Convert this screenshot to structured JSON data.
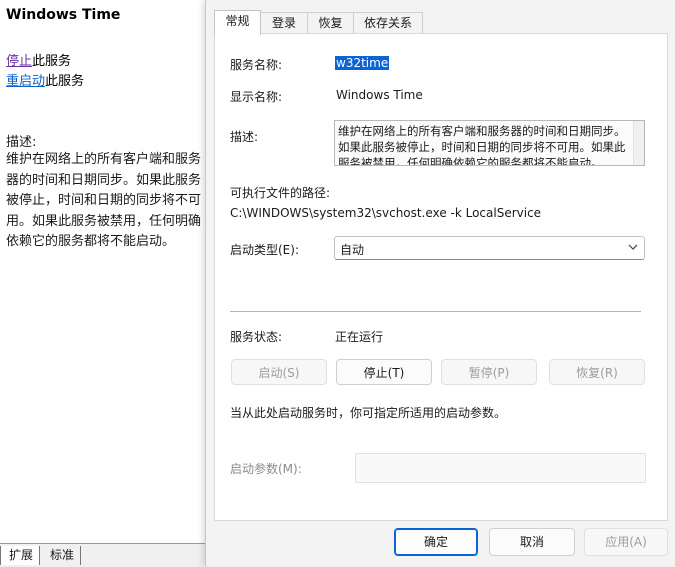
{
  "left_pane": {
    "title": "Windows Time",
    "stop_link": "停止",
    "stop_suffix": "此服务",
    "restart_link": "重启动",
    "restart_suffix": "此服务",
    "description_label": "描述:",
    "description": "维护在网络上的所有客户端和服务器的时间和日期同步。如果此服务被停止，时间和日期的同步将不可用。如果此服务被禁用，任何明确依赖它的服务都将不能启动。",
    "tabs": [
      "扩展",
      "标准"
    ]
  },
  "dialog": {
    "tabs": [
      "常规",
      "登录",
      "恢复",
      "依存关系"
    ],
    "active_tab": "常规",
    "service_name_label": "服务名称:",
    "service_name": "w32time",
    "display_name_label": "显示名称:",
    "display_name": "Windows Time",
    "description_label": "描述:",
    "description": "维护在网络上的所有客户端和服务器的时间和日期同步。如果此服务被停止，时间和日期的同步将不可用。如果此服务被禁用，任何明确依赖它的服务都将不能启动。",
    "exe_path_label": "可执行文件的路径:",
    "exe_path": "C:\\WINDOWS\\system32\\svchost.exe -k LocalService",
    "startup_type_label": "启动类型(E):",
    "startup_type_value": "自动",
    "service_status_label": "服务状态:",
    "service_status_value": "正在运行",
    "start_button": "启动(S)",
    "stop_button": "停止(T)",
    "pause_button": "暂停(P)",
    "resume_button": "恢复(R)",
    "hint_text": "当从此处启动服务时，你可指定所适用的启动参数。",
    "start_params_label": "启动参数(M):",
    "start_params_value": "",
    "ok_button": "确定",
    "cancel_button": "取消",
    "apply_button": "应用(A)"
  },
  "colors": {
    "accent": "#0a64d6",
    "link": "#0b62c9",
    "visited_link": "#6b2ea4",
    "disabled_text": "#9d9d9d"
  },
  "icons": {
    "combo_arrow": "chevron-down-icon"
  }
}
